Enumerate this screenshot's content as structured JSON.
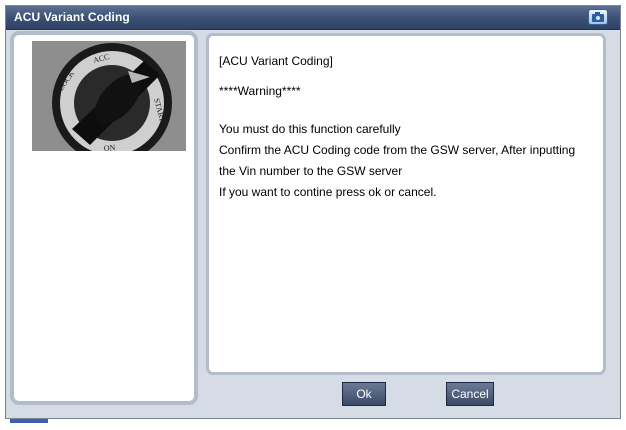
{
  "window": {
    "title": "ACU Variant Coding"
  },
  "image": {
    "description_icon": "ignition-key-icon",
    "labels": [
      "LOCK",
      "ACC",
      "START",
      "ON"
    ]
  },
  "message": {
    "heading": "[ACU Variant Coding]",
    "warning": "****Warning****",
    "lines": [
      "You must do this function carefully",
      "Confirm the ACU Coding code from the GSW server, After inputting",
      "the Vin number to the GSW server",
      "If you want to contine press ok or cancel."
    ]
  },
  "buttons": {
    "ok": "Ok",
    "cancel": "Cancel"
  },
  "colors": {
    "titlebar": "#3a4f74",
    "button": "#4a5874",
    "panel_border": "#b3bccb"
  }
}
